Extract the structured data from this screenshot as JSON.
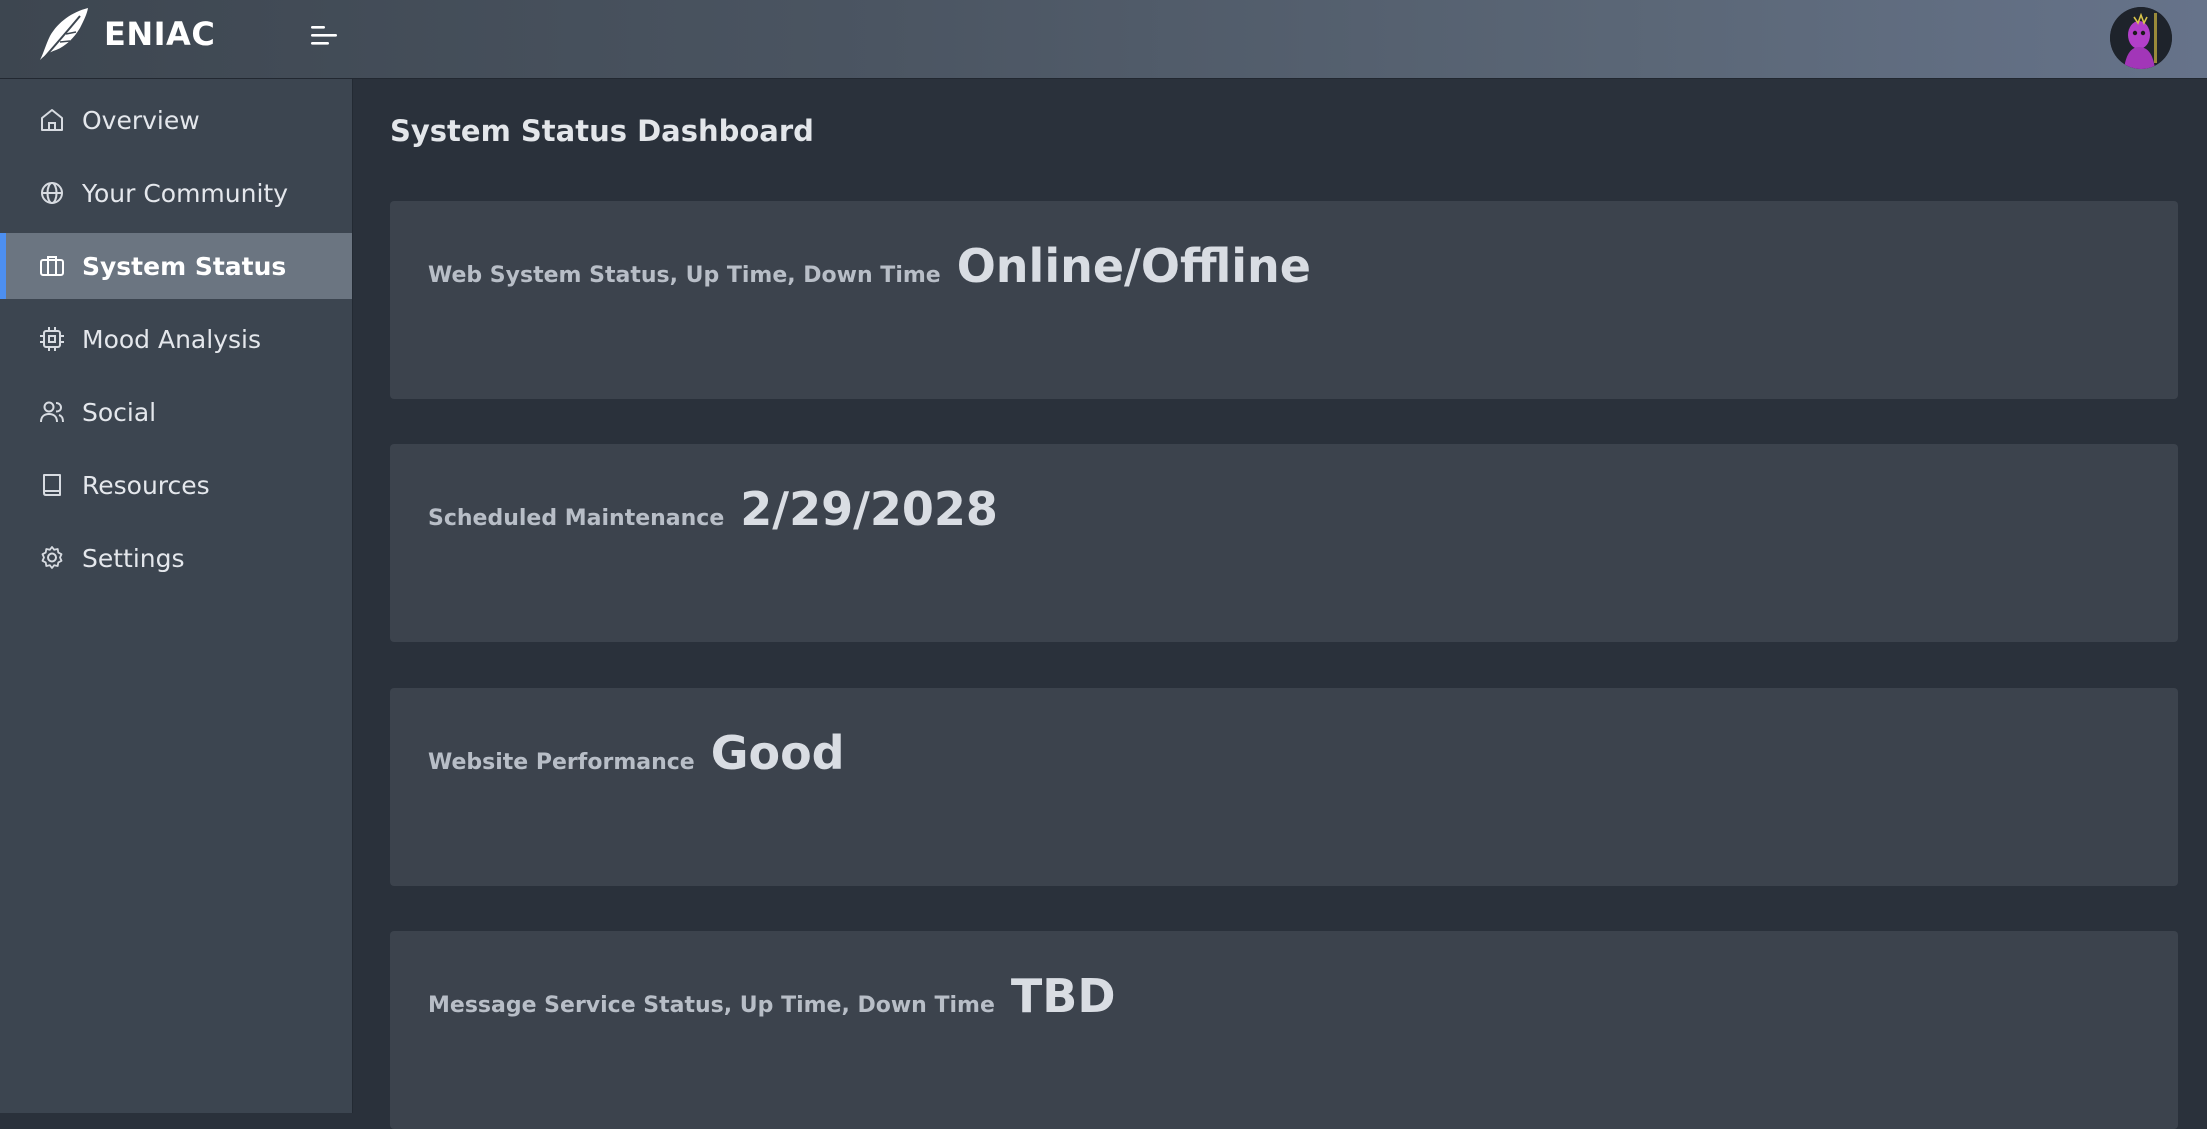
{
  "header": {
    "brand": "ENIAC",
    "icons": {
      "logo": "feather-logo-icon",
      "menu": "menu-toggle-icon",
      "avatar": "user-avatar"
    }
  },
  "sidebar": {
    "items": [
      {
        "label": "Overview",
        "icon": "home-icon",
        "active": false
      },
      {
        "label": "Your Community",
        "icon": "globe-icon",
        "active": false
      },
      {
        "label": "System Status",
        "icon": "briefcase-icon",
        "active": true
      },
      {
        "label": "Mood Analysis",
        "icon": "cpu-icon",
        "active": false
      },
      {
        "label": "Social",
        "icon": "users-icon",
        "active": false
      },
      {
        "label": "Resources",
        "icon": "book-icon",
        "active": false
      },
      {
        "label": "Settings",
        "icon": "gear-icon",
        "active": false
      }
    ]
  },
  "main": {
    "title": "System Status Dashboard",
    "cards": [
      {
        "label": "Web System Status, Up Time, Down Time",
        "value": "Online/Offline"
      },
      {
        "label": "Scheduled Maintenance",
        "value": "2/29/2028"
      },
      {
        "label": "Website Performance",
        "value": "Good"
      },
      {
        "label": "Message Service Status, Up Time, Down Time",
        "value": "TBD"
      }
    ]
  },
  "colors": {
    "accent": "#4d8ff0",
    "sidebar_bg": "#3c4550",
    "content_bg": "#2a313b",
    "card_bg": "#3c434d",
    "active_item_bg": "#6b7581"
  }
}
